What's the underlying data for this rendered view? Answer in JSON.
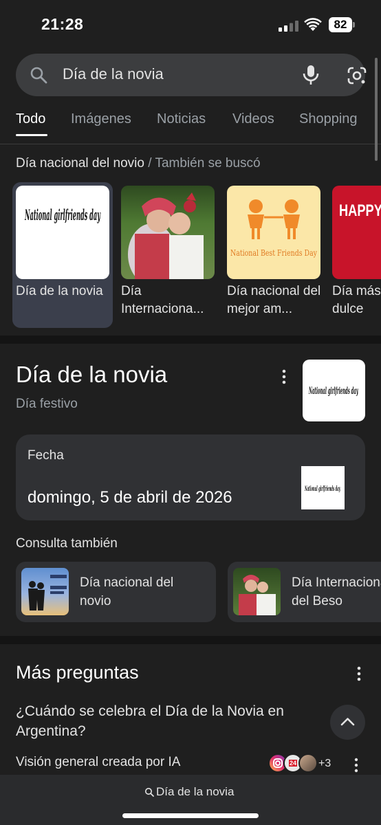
{
  "status": {
    "time": "21:28",
    "battery": "82"
  },
  "search": {
    "query": "Día de la novia"
  },
  "tabs": [
    "Todo",
    "Imágenes",
    "Noticias",
    "Videos",
    "Shopping"
  ],
  "related_section": {
    "title": "Día nacional del novio",
    "separator": " / ",
    "subtitle": "También se buscó"
  },
  "carousel": [
    {
      "label": "Día de la novia",
      "image_text": "National girlfriends day"
    },
    {
      "label": "Día Internaciona..."
    },
    {
      "label": "Día nacional del mejor am...",
      "image_text": "National Best Friends Day"
    },
    {
      "label": "Día más dulce",
      "image_text": "HAPPY SWEETEST DAY"
    }
  ],
  "knowledge_panel": {
    "title": "Día de la novia",
    "subtitle": "Día festivo",
    "date_label": "Fecha",
    "date_value": "domingo, 5 de abril de 2026",
    "see_also_title": "Consulta también",
    "see_also": [
      {
        "label": "Día nacional del\nnovio"
      },
      {
        "label": "Día Internacional\ndel Beso"
      }
    ]
  },
  "more_questions": {
    "title": "Más preguntas",
    "question": "¿Cuándo se celebra el Día de la Novia en Argentina?",
    "ai_overview": "Visión general creada por IA",
    "sources_more": "+3",
    "source_badge": "24"
  },
  "bottom": {
    "query": "Día de la novia"
  },
  "colors": {
    "background": "#1f1f1f",
    "surface": "#303134",
    "search": "#3c3d3f",
    "selected": "#3b3f4c"
  }
}
